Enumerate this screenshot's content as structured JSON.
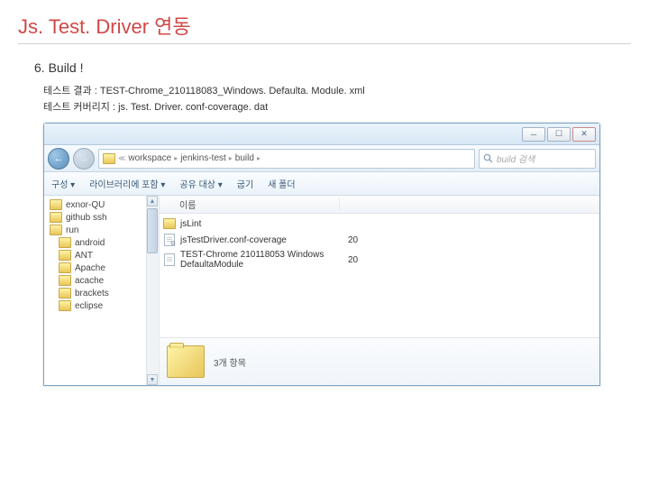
{
  "slide": {
    "title": "Js. Test. Driver 연동",
    "step": "6.  Build !",
    "result_label": "테스트 결과  :",
    "result_value": "TEST-Chrome_210118083_Windows. Defaulta. Module. xml",
    "coverage_label": "테스트 커버리지 :",
    "coverage_value": "js. Test. Driver. conf-coverage. dat"
  },
  "breadcrumb": {
    "items": [
      "workspace",
      "jenkins-test",
      "build"
    ]
  },
  "search": {
    "placeholder": "build 검색"
  },
  "toolbar": {
    "organize": "구성 ▾",
    "include": "라이브러리에 포함 ▾",
    "share": "공유 대상 ▾",
    "burn": "굽기",
    "newfolder": "새 폴더"
  },
  "tree": {
    "items": [
      {
        "label": "exnor-QU"
      },
      {
        "label": "github ssh"
      },
      {
        "label": "run"
      },
      {
        "label": "android"
      },
      {
        "label": "ANT"
      },
      {
        "label": "Apache"
      },
      {
        "label": "acache"
      },
      {
        "label": "brackets"
      },
      {
        "label": "eclipse"
      }
    ]
  },
  "columns": {
    "name": "이름"
  },
  "files": {
    "items": [
      {
        "name": "jsLint",
        "icon": "folder",
        "col2": ""
      },
      {
        "name": "jsTestDriver.conf-coverage",
        "icon": "gear",
        "col2": "20"
      },
      {
        "name": "TEST-Chrome 210118053 Windows DefaultaModule",
        "icon": "doc",
        "col2": "20"
      }
    ]
  },
  "preview": {
    "text": "3개 항목"
  }
}
